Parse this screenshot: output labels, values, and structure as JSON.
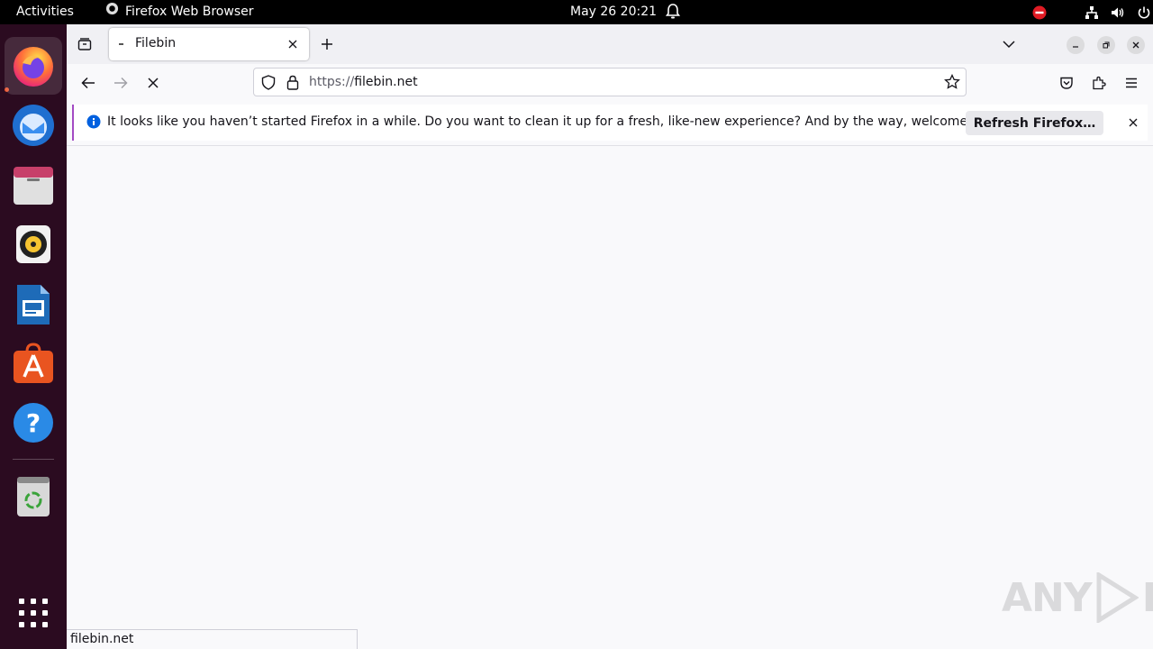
{
  "topbar": {
    "activities": "Activities",
    "app_name": "Firefox Web Browser",
    "clock": "May 26  20:21"
  },
  "dock": {
    "apps": [
      "firefox-icon",
      "thunderbird-icon",
      "files-icon",
      "rhythmbox-icon",
      "libreoffice-impress-icon",
      "app-center-icon",
      "help-icon",
      "trash-icon",
      "show-apps-icon"
    ]
  },
  "browser": {
    "tab_title": "Filebin",
    "url_scheme": "https://",
    "url_host": "filebin.net",
    "notification": {
      "message": "It looks like you haven’t started Firefox in a while. Do you want to clean it up for a fresh, like-new experience? And by the way, welcome back!",
      "button": "Refresh Firefox…"
    },
    "status_text": "filebin.net"
  },
  "watermark": {
    "left": "ANY",
    "right": "RUN"
  },
  "colors": {
    "accent": "#a34bc4",
    "info": "#0060df",
    "dock_bg": "#2b0b20"
  }
}
